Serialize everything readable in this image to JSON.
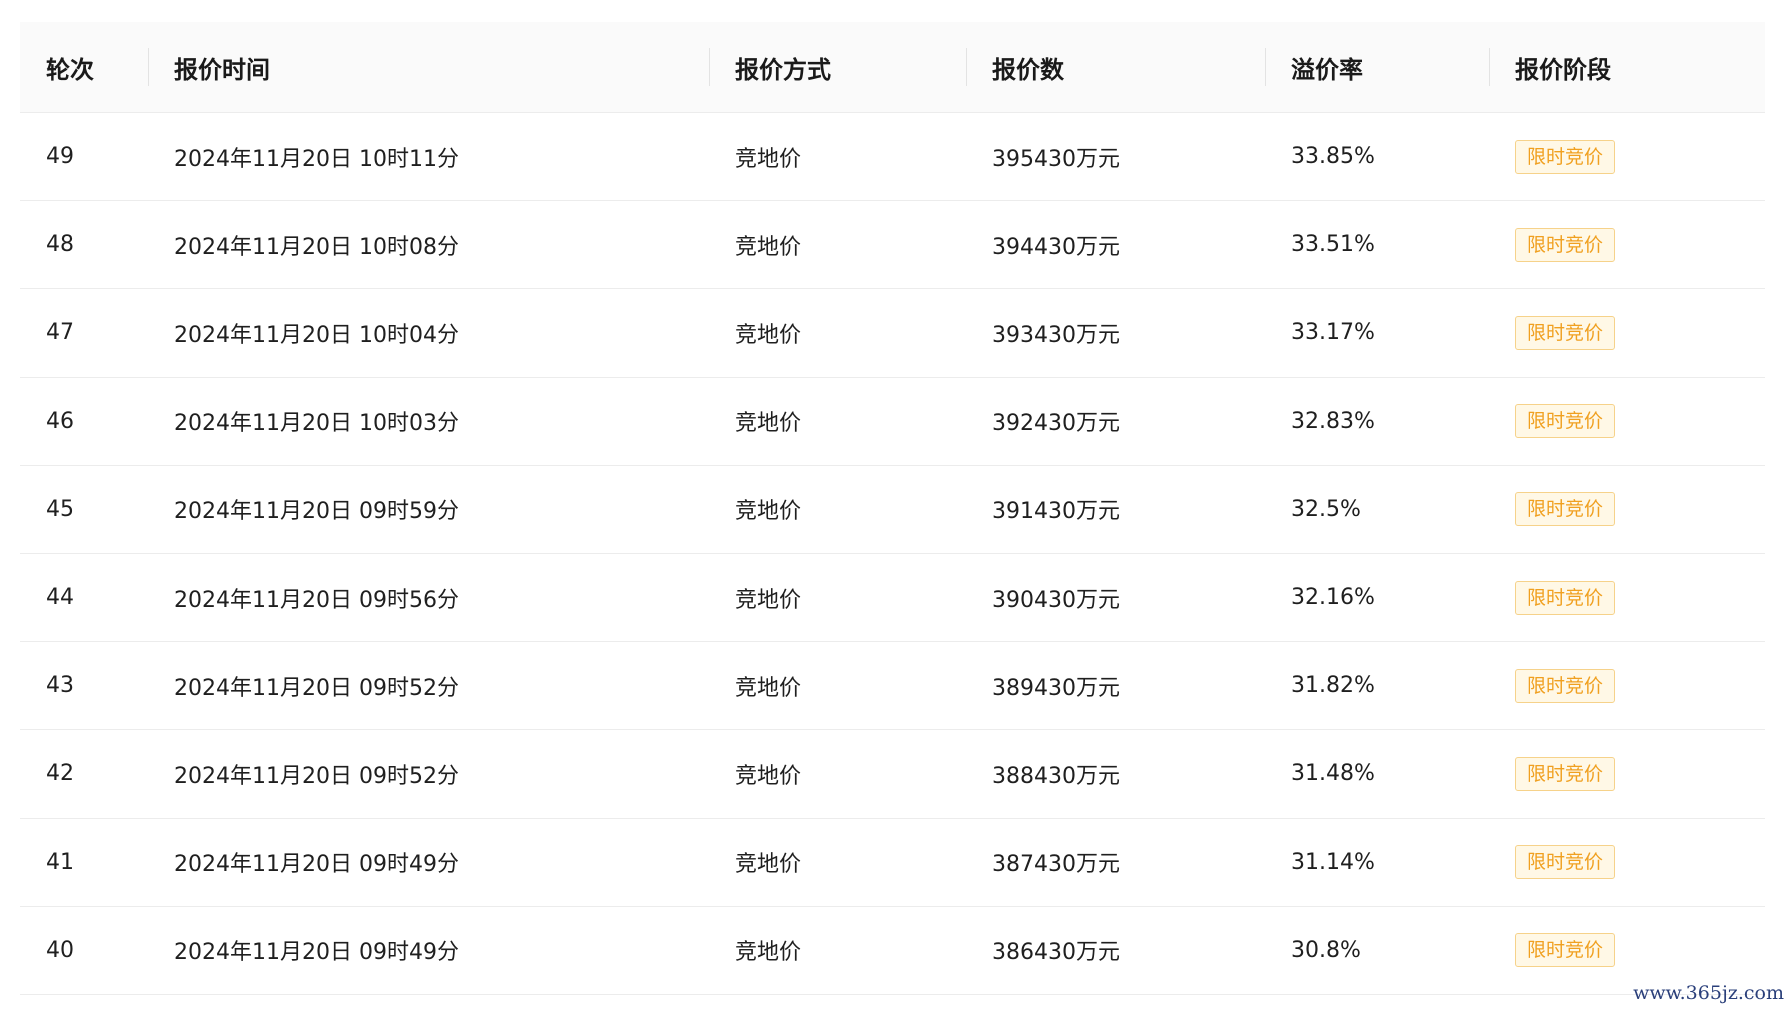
{
  "table": {
    "headers": [
      "轮次",
      "报价时间",
      "报价方式",
      "报价数",
      "溢价率",
      "报价阶段"
    ],
    "rows": [
      {
        "round": "49",
        "time": "2024年11月20日 10时11分",
        "mode": "竞地价",
        "count": "395430万元",
        "rate": "33.85%",
        "stage": "限时竞价"
      },
      {
        "round": "48",
        "time": "2024年11月20日 10时08分",
        "mode": "竞地价",
        "count": "394430万元",
        "rate": "33.51%",
        "stage": "限时竞价"
      },
      {
        "round": "47",
        "time": "2024年11月20日 10时04分",
        "mode": "竞地价",
        "count": "393430万元",
        "rate": "33.17%",
        "stage": "限时竞价"
      },
      {
        "round": "46",
        "time": "2024年11月20日 10时03分",
        "mode": "竞地价",
        "count": "392430万元",
        "rate": "32.83%",
        "stage": "限时竞价"
      },
      {
        "round": "45",
        "time": "2024年11月20日 09时59分",
        "mode": "竞地价",
        "count": "391430万元",
        "rate": "32.5%",
        "stage": "限时竞价"
      },
      {
        "round": "44",
        "time": "2024年11月20日 09时56分",
        "mode": "竞地价",
        "count": "390430万元",
        "rate": "32.16%",
        "stage": "限时竞价"
      },
      {
        "round": "43",
        "time": "2024年11月20日 09时52分",
        "mode": "竞地价",
        "count": "389430万元",
        "rate": "31.82%",
        "stage": "限时竞价"
      },
      {
        "round": "42",
        "time": "2024年11月20日 09时52分",
        "mode": "竞地价",
        "count": "388430万元",
        "rate": "31.48%",
        "stage": "限时竞价"
      },
      {
        "round": "41",
        "time": "2024年11月20日 09时49分",
        "mode": "竞地价",
        "count": "387430万元",
        "rate": "31.14%",
        "stage": "限时竞价"
      },
      {
        "round": "40",
        "time": "2024年11月20日 09时49分",
        "mode": "竞地价",
        "count": "386430万元",
        "rate": "30.8%",
        "stage": "限时竞价"
      }
    ]
  },
  "watermark": "www.365jz.com",
  "colors": {
    "badge_text": "#f0a020",
    "badge_bg": "#fff8e6",
    "badge_border": "#f6d28a",
    "header_bg": "#fafafa"
  }
}
